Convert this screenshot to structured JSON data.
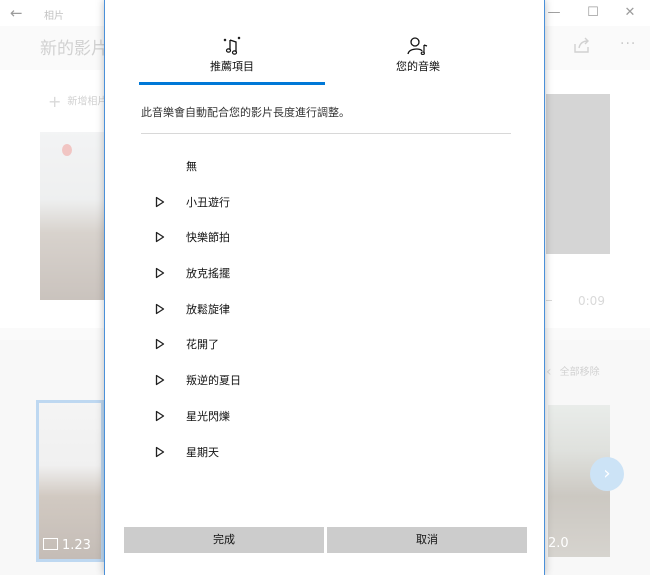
{
  "app": {
    "title": "相片",
    "project_title": "新的影片",
    "add_photo_label": "新增相片",
    "total_time": "0:09",
    "remove_all_label": "全部移除",
    "clips": [
      {
        "duration": "1.23"
      },
      {
        "duration": "2.0"
      }
    ],
    "window_controls": {
      "minimize": "—",
      "maximize": "☐",
      "close": "✕"
    },
    "colors": {
      "accent": "#0078d7",
      "selected_clip": "#70a9df",
      "next_button": "#8ec0ec"
    }
  },
  "dialog": {
    "tabs": [
      {
        "label": "推薦項目",
        "icon": "magic-music-icon",
        "selected": true
      },
      {
        "label": "您的音樂",
        "icon": "person-music-icon",
        "selected": false
      }
    ],
    "hint": "此音樂會自動配合您的影片長度進行調整。",
    "music_items": [
      {
        "label": "無",
        "has_play": false
      },
      {
        "label": "小丑遊行",
        "has_play": true
      },
      {
        "label": "快樂節拍",
        "has_play": true
      },
      {
        "label": "放克搖擺",
        "has_play": true
      },
      {
        "label": "放鬆旋律",
        "has_play": true
      },
      {
        "label": "花開了",
        "has_play": true
      },
      {
        "label": "叛逆的夏日",
        "has_play": true
      },
      {
        "label": "星光閃爍",
        "has_play": true
      },
      {
        "label": "星期天",
        "has_play": true
      }
    ],
    "buttons": {
      "done": "完成",
      "cancel": "取消"
    }
  }
}
